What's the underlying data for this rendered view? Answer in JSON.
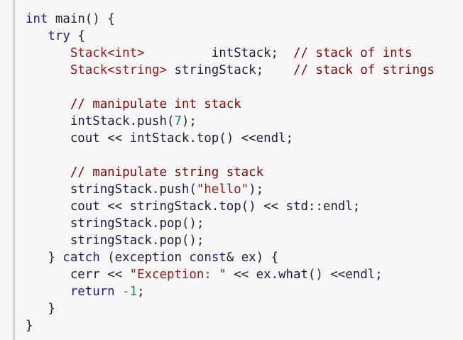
{
  "code": {
    "lines": [
      [
        {
          "t": "int",
          "c": "kw"
        },
        {
          "t": " "
        },
        {
          "t": "main",
          "c": "id"
        },
        {
          "t": "()",
          "c": "punc"
        },
        {
          "t": " "
        },
        {
          "t": "{",
          "c": "punc"
        }
      ],
      [
        {
          "t": "   "
        },
        {
          "t": "try",
          "c": "kw"
        },
        {
          "t": " "
        },
        {
          "t": "{",
          "c": "punc"
        }
      ],
      [
        {
          "t": "      "
        },
        {
          "t": "Stack<int>",
          "c": "type"
        },
        {
          "t": "         "
        },
        {
          "t": "intStack;",
          "c": "id"
        },
        {
          "t": "  "
        },
        {
          "t": "// stack of ints",
          "c": "com"
        }
      ],
      [
        {
          "t": "      "
        },
        {
          "t": "Stack<string>",
          "c": "type"
        },
        {
          "t": " "
        },
        {
          "t": "stringStack;",
          "c": "id"
        },
        {
          "t": "    "
        },
        {
          "t": "// stack of strings",
          "c": "com"
        }
      ],
      [
        {
          "t": ""
        }
      ],
      [
        {
          "t": "      "
        },
        {
          "t": "// manipulate int stack",
          "c": "com"
        }
      ],
      [
        {
          "t": "      "
        },
        {
          "t": "intStack.push(",
          "c": "id"
        },
        {
          "t": "7",
          "c": "num"
        },
        {
          "t": ");",
          "c": "punc"
        }
      ],
      [
        {
          "t": "      "
        },
        {
          "t": "cout",
          "c": "id"
        },
        {
          "t": " << ",
          "c": "op"
        },
        {
          "t": "intStack.top()",
          "c": "id"
        },
        {
          "t": " <<",
          "c": "op"
        },
        {
          "t": "endl;",
          "c": "id"
        }
      ],
      [
        {
          "t": ""
        }
      ],
      [
        {
          "t": "      "
        },
        {
          "t": "// manipulate string stack",
          "c": "com"
        }
      ],
      [
        {
          "t": "      "
        },
        {
          "t": "stringStack.push(",
          "c": "id"
        },
        {
          "t": "\"hello\"",
          "c": "str"
        },
        {
          "t": ");",
          "c": "punc"
        }
      ],
      [
        {
          "t": "      "
        },
        {
          "t": "cout",
          "c": "id"
        },
        {
          "t": " << ",
          "c": "op"
        },
        {
          "t": "stringStack.top()",
          "c": "id"
        },
        {
          "t": " << ",
          "c": "op"
        },
        {
          "t": "std::endl;",
          "c": "id"
        }
      ],
      [
        {
          "t": "      "
        },
        {
          "t": "stringStack.pop();",
          "c": "id"
        }
      ],
      [
        {
          "t": "      "
        },
        {
          "t": "stringStack.pop();",
          "c": "id"
        }
      ],
      [
        {
          "t": "   "
        },
        {
          "t": "}",
          "c": "punc"
        },
        {
          "t": " "
        },
        {
          "t": "catch",
          "c": "kw"
        },
        {
          "t": " "
        },
        {
          "t": "(exception ",
          "c": "id"
        },
        {
          "t": "const",
          "c": "kw"
        },
        {
          "t": "& ex) {",
          "c": "punc"
        }
      ],
      [
        {
          "t": "      "
        },
        {
          "t": "cerr",
          "c": "id"
        },
        {
          "t": " << ",
          "c": "op"
        },
        {
          "t": "\"Exception: \"",
          "c": "str"
        },
        {
          "t": " << ",
          "c": "op"
        },
        {
          "t": "ex.what()",
          "c": "id"
        },
        {
          "t": " <<",
          "c": "op"
        },
        {
          "t": "endl;",
          "c": "id"
        }
      ],
      [
        {
          "t": "      "
        },
        {
          "t": "return",
          "c": "kw"
        },
        {
          "t": " "
        },
        {
          "t": "-1",
          "c": "num"
        },
        {
          "t": ";",
          "c": "punc"
        }
      ],
      [
        {
          "t": "   "
        },
        {
          "t": "}",
          "c": "punc"
        }
      ],
      [
        {
          "t": "}",
          "c": "punc"
        }
      ]
    ]
  }
}
